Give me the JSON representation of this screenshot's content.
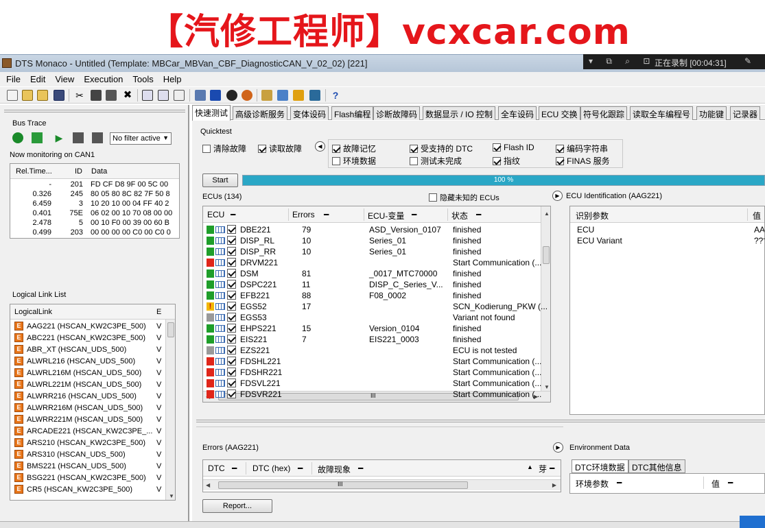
{
  "banner": {
    "watermark": "【汽修工程师】vcxcar.com"
  },
  "window": {
    "title": "DTS Monaco  - Untitled (Template: MBCar_MBVan_CBF_DiagnosticCAN_V_02_02) [221]"
  },
  "recorder": {
    "icons": "▾ ⧉ ⌕ ⊡",
    "text": "正在录制 [00:04:31]"
  },
  "menu": [
    "File",
    "Edit",
    "View",
    "Execution",
    "Tools",
    "Help"
  ],
  "bus_trace": {
    "title": "Bus Trace",
    "filter": "No filter active",
    "monitoring": "Now monitoring on CAN1",
    "columns": [
      "Rel.Time...",
      "ID",
      "Data"
    ],
    "rows": [
      {
        "time": "-",
        "id": "201",
        "data": "FD CF D8 9F 00 5C 00"
      },
      {
        "time": "0.326",
        "id": "245",
        "data": "80 05 80 8C 82 7F 50 8"
      },
      {
        "time": "6.459",
        "id": "3",
        "data": "10 20 10 00 04 FF 40 2"
      },
      {
        "time": "0.401",
        "id": "75E",
        "data": "06 02 00 10 70 08 00 00"
      },
      {
        "time": "2.478",
        "id": "5",
        "data": "00 10 F0 00 39 00 60 B"
      },
      {
        "time": "0.499",
        "id": "203",
        "data": "00 00 00 00 C0 00 C0 0"
      }
    ]
  },
  "logical_link": {
    "title": "Logical Link List",
    "columns": [
      "LogicalLink",
      "E"
    ],
    "icon_letter": "E",
    "rows": [
      {
        "label": "AAG221 (HSCAN_KW2C3PE_500)",
        "v": "V"
      },
      {
        "label": "ABC221 (HSCAN_KW2C3PE_500)",
        "v": "V"
      },
      {
        "label": "ABR_XT (HSCAN_UDS_500)",
        "v": "V"
      },
      {
        "label": "ALWRL216 (HSCAN_UDS_500)",
        "v": "V"
      },
      {
        "label": "ALWRL216M (HSCAN_UDS_500)",
        "v": "V"
      },
      {
        "label": "ALWRL221M (HSCAN_UDS_500)",
        "v": "V"
      },
      {
        "label": "ALWRR216 (HSCAN_UDS_500)",
        "v": "V"
      },
      {
        "label": "ALWRR216M (HSCAN_UDS_500)",
        "v": "V"
      },
      {
        "label": "ALWRR221M (HSCAN_UDS_500)",
        "v": "V"
      },
      {
        "label": "ARCADE221 (HSCAN_KW2C3PE_...",
        "v": "V"
      },
      {
        "label": "ARS210 (HSCAN_KW2C3PE_500)",
        "v": "V"
      },
      {
        "label": "ARS310 (HSCAN_UDS_500)",
        "v": "V"
      },
      {
        "label": "BMS221 (HSCAN_UDS_500)",
        "v": "V"
      },
      {
        "label": "BSG221 (HSCAN_KW2C3PE_500)",
        "v": "V"
      },
      {
        "label": "CR5 (HSCAN_KW2C3PE_500)",
        "v": "V"
      }
    ]
  },
  "tabs": [
    "快速测试",
    "高级诊断服务",
    "变体设码",
    "Flash编程",
    "诊断故障码",
    "数据显示 / IO 控制",
    "全车设码",
    "ECU 交换",
    "符号化跟踪",
    "读取全车编程号",
    "功能键",
    "记录器"
  ],
  "quicktest": {
    "title": "Quicktest",
    "left_checks": [
      {
        "label": "清除故障",
        "checked": false
      },
      {
        "label": "读取故障",
        "checked": true
      }
    ],
    "collapse_icon": "◀",
    "options": [
      {
        "label": "故障记忆",
        "checked": true
      },
      {
        "label": "受支持的 DTC",
        "checked": true
      },
      {
        "label": "Flash ID",
        "checked": true
      },
      {
        "label": "编码字符串",
        "checked": true
      },
      {
        "label": "环境数据",
        "checked": false
      },
      {
        "label": "测试未完成",
        "checked": false
      },
      {
        "label": "指纹",
        "checked": true
      },
      {
        "label": "FINAS 服务",
        "checked": true
      }
    ],
    "start_label": "Start",
    "progress": 100,
    "progress_text": "100 %",
    "hide_unknown_label": "隐藏未知的 ECUs"
  },
  "ecu_list": {
    "title": "ECUs (134)",
    "columns": [
      "ECU",
      "Errors",
      "ECU-变量",
      "状态"
    ],
    "status_colors": {
      "green": "#1f9e2a",
      "red": "#e0261a",
      "gray": "#9a9a9a",
      "warn": "#f2b705"
    },
    "rows": [
      {
        "status": "green",
        "ecu": "DBE221",
        "errors": "79",
        "variant": "ASD_Version_0107",
        "state": "finished"
      },
      {
        "status": "green",
        "ecu": "DISP_RL",
        "errors": "10",
        "variant": "Series_01",
        "state": "finished"
      },
      {
        "status": "green",
        "ecu": "DISP_RR",
        "errors": "10",
        "variant": "Series_01",
        "state": "finished"
      },
      {
        "status": "red",
        "ecu": "DRVM221",
        "errors": "",
        "variant": "",
        "state": "Start Communication (..."
      },
      {
        "status": "green",
        "ecu": "DSM",
        "errors": "81",
        "variant": "_0017_MTC70000",
        "state": "finished"
      },
      {
        "status": "green",
        "ecu": "DSPC221",
        "errors": "11",
        "variant": "DISP_C_Series_V...",
        "state": "finished"
      },
      {
        "status": "green",
        "ecu": "EFB221",
        "errors": "88",
        "variant": "F08_0002",
        "state": "finished"
      },
      {
        "status": "warn",
        "ecu": "EGS52",
        "errors": "17",
        "variant": "",
        "state": "SCN_Kodierung_PKW (..."
      },
      {
        "status": "gray",
        "ecu": "EGS53",
        "errors": "",
        "variant": "",
        "state": "Variant not found"
      },
      {
        "status": "green",
        "ecu": "EHPS221",
        "errors": "15",
        "variant": "Version_0104",
        "state": "finished"
      },
      {
        "status": "green",
        "ecu": "EIS221",
        "errors": "7",
        "variant": "EIS221_0003",
        "state": "finished"
      },
      {
        "status": "gray",
        "ecu": "EZS221",
        "errors": "",
        "variant": "",
        "state": "ECU is not tested"
      },
      {
        "status": "red",
        "ecu": "FDSHL221",
        "errors": "",
        "variant": "",
        "state": "Start Communication (..."
      },
      {
        "status": "red",
        "ecu": "FDSHR221",
        "errors": "",
        "variant": "",
        "state": "Start Communication (..."
      },
      {
        "status": "red",
        "ecu": "FDSVL221",
        "errors": "",
        "variant": "",
        "state": "Start Communication (..."
      },
      {
        "status": "red",
        "ecu": "FDSVR221",
        "errors": "",
        "variant": "",
        "state": "Start Communication (..."
      }
    ]
  },
  "ecu_ident": {
    "title": "ECU Identification (AAG221)",
    "columns": [
      "识别参数",
      "值"
    ],
    "rows": [
      {
        "param": "ECU",
        "value": "AA"
      },
      {
        "param": "ECU Variant",
        "value": "???"
      }
    ]
  },
  "errors": {
    "title": "Errors (AAG221)",
    "columns": [
      "DTC",
      "DTC (hex)",
      "故障现象"
    ],
    "extra": "芽"
  },
  "env": {
    "title": "Environment Data",
    "tabs": [
      "DTC环境数据",
      "DTC其他信息"
    ],
    "columns": [
      "环境参数",
      "值"
    ]
  },
  "report_label": "Report..."
}
